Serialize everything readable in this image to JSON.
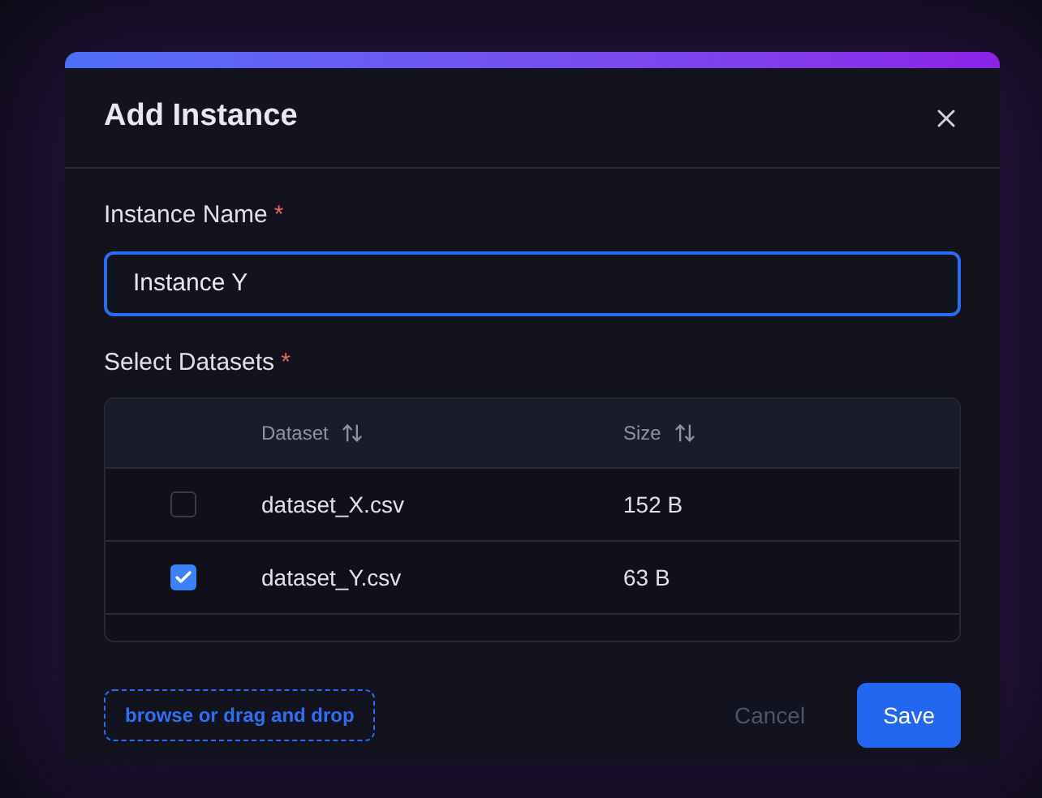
{
  "dialog": {
    "title": "Add Instance"
  },
  "name_field": {
    "label": "Instance Name",
    "required_mark": "*",
    "value": "Instance Y"
  },
  "datasets": {
    "label": "Select Datasets",
    "required_mark": "*",
    "columns": [
      {
        "label": "Dataset",
        "sortable": true
      },
      {
        "label": "Size",
        "sortable": true
      }
    ],
    "rows": [
      {
        "name": "dataset_X.csv",
        "size": "152 B",
        "checked": false
      },
      {
        "name": "dataset_Y.csv",
        "size": "63 B",
        "checked": true
      }
    ]
  },
  "upload": {
    "label": "browse or drag and drop"
  },
  "buttons": {
    "cancel": "Cancel",
    "save": "Save"
  }
}
